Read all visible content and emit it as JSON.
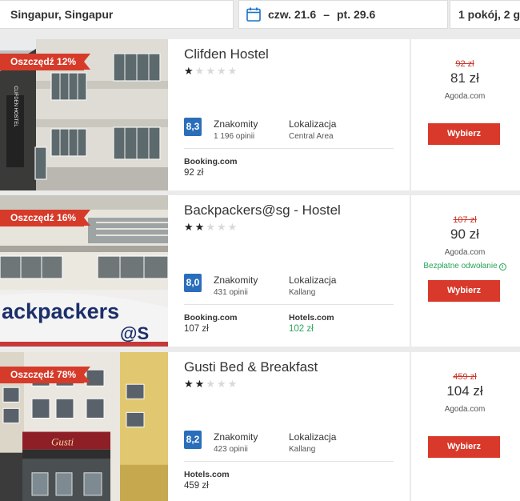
{
  "search": {
    "location": "Singapur, Singapur",
    "check_in": "czw. 21.6",
    "separator": "–",
    "check_out": "pt. 29.6",
    "rooms": "1 pokój, 2 g"
  },
  "hotels": [
    {
      "discount": "Oszczędź 12%",
      "name": "Clifden Hostel",
      "stars": 1,
      "rating": "8,3",
      "rating_label": "Znakomity",
      "rating_count": "1 196 opinii",
      "location_label": "Lokalizacja",
      "location_value": "Central Area",
      "offers": [
        {
          "site": "Booking.com",
          "price": "92 zł",
          "highlight": false
        }
      ],
      "old_price": "92 zł",
      "price": "81 zł",
      "price_site": "Agoda.com",
      "free_cancel": "",
      "button": "Wybierz"
    },
    {
      "discount": "Oszczędź 16%",
      "name": "Backpackers@sg - Hostel",
      "stars": 2,
      "rating": "8,0",
      "rating_label": "Znakomity",
      "rating_count": "431 opinii",
      "location_label": "Lokalizacja",
      "location_value": "Kallang",
      "offers": [
        {
          "site": "Booking.com",
          "price": "107 zł",
          "highlight": false
        },
        {
          "site": "Hotels.com",
          "price": "102 zł",
          "highlight": true
        }
      ],
      "old_price": "107 zł",
      "price": "90 zł",
      "price_site": "Agoda.com",
      "free_cancel": "Bezpłatne odwołanie",
      "button": "Wybierz"
    },
    {
      "discount": "Oszczędź 78%",
      "name": "Gusti Bed & Breakfast",
      "stars": 2,
      "rating": "8,2",
      "rating_label": "Znakomity",
      "rating_count": "423 opinii",
      "location_label": "Lokalizacja",
      "location_value": "Kallang",
      "offers": [
        {
          "site": "Hotels.com",
          "price": "459 zł",
          "highlight": false
        }
      ],
      "old_price": "459 zł",
      "price": "104 zł",
      "price_site": "Agoda.com",
      "free_cancel": "",
      "button": "Wybierz"
    }
  ],
  "photo_signs": {
    "hostel_sign": "CLIFDEN HOSTEL",
    "banner": "ackpackers",
    "banner_sub": "@S",
    "shop_sign": "Gusti"
  },
  "icons": {
    "calendar": "calendar-icon",
    "info": "info-icon"
  },
  "colors": {
    "accent_red": "#d8392b",
    "rating_blue": "#2a6ebb",
    "green": "#2aa55a",
    "calendar_blue": "#1a73c8"
  }
}
